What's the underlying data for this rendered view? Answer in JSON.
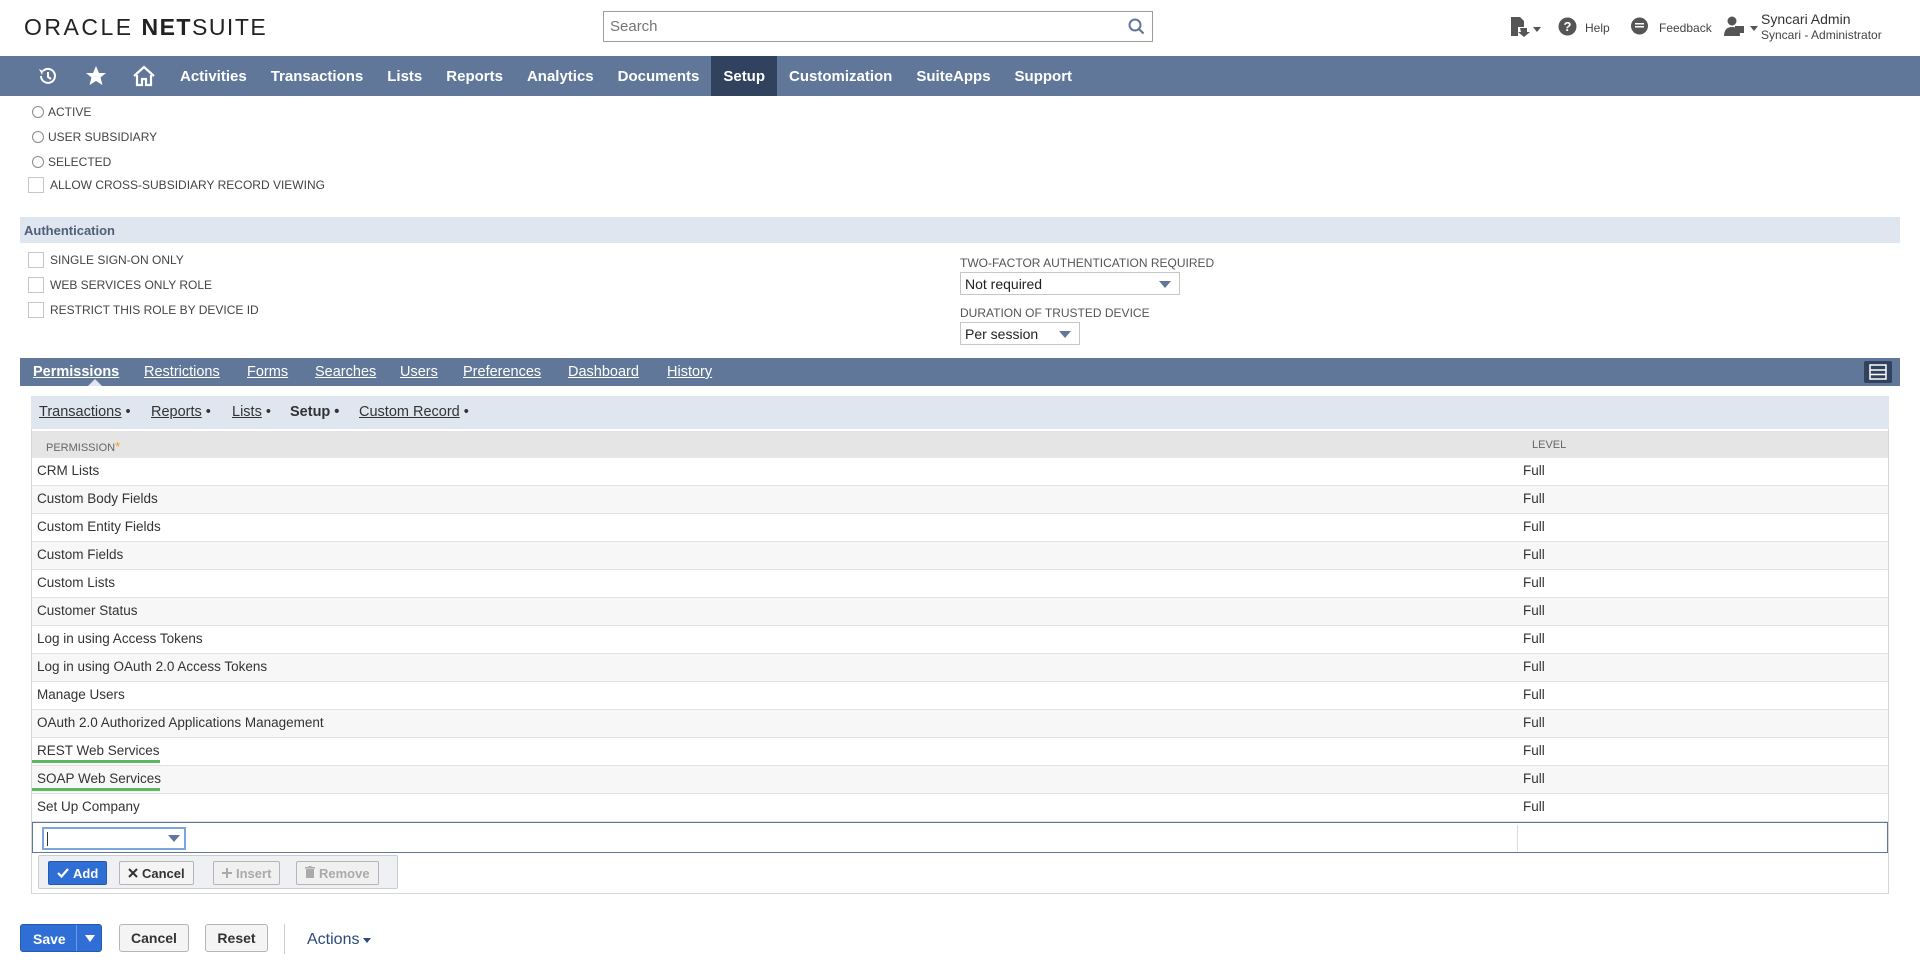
{
  "header": {
    "logo_oracle": "ORACLE",
    "logo_net": "NET",
    "logo_suite": "SUITE",
    "search_placeholder": "Search",
    "help_label": "Help",
    "feedback_label": "Feedback",
    "user_name": "Syncari Admin",
    "user_role": "Syncari - Administrator"
  },
  "nav": {
    "items": [
      "Activities",
      "Transactions",
      "Lists",
      "Reports",
      "Analytics",
      "Documents",
      "Setup",
      "Customization",
      "SuiteApps",
      "Support"
    ],
    "active": "Setup"
  },
  "subsidiary_options": {
    "radio_active": "ACTIVE",
    "radio_user_subsidiary": "USER SUBSIDIARY",
    "radio_selected": "SELECTED",
    "cross_subsidiary": "ALLOW CROSS-SUBSIDIARY RECORD VIEWING"
  },
  "authentication": {
    "title": "Authentication",
    "sso_only": "SINGLE SIGN-ON ONLY",
    "web_services_only": "WEB SERVICES ONLY ROLE",
    "restrict_device": "RESTRICT THIS ROLE BY DEVICE ID",
    "two_factor_label": "TWO-FACTOR AUTHENTICATION REQUIRED",
    "two_factor_value": "Not required",
    "duration_label": "DURATION OF TRUSTED DEVICE",
    "duration_value": "Per session"
  },
  "tabs": {
    "items": [
      "Permissions",
      "Restrictions",
      "Forms",
      "Searches",
      "Users",
      "Preferences",
      "Dashboard",
      "History"
    ],
    "active": "Permissions"
  },
  "subtabs": {
    "items": [
      "Transactions",
      "Reports",
      "Lists",
      "Setup",
      "Custom Record"
    ],
    "active": "Setup"
  },
  "table": {
    "col_permission": "PERMISSION",
    "col_required": "*",
    "col_level": "LEVEL",
    "rows": [
      {
        "permission": "CRM Lists",
        "level": "Full"
      },
      {
        "permission": "Custom Body Fields",
        "level": "Full"
      },
      {
        "permission": "Custom Entity Fields",
        "level": "Full"
      },
      {
        "permission": "Custom Fields",
        "level": "Full"
      },
      {
        "permission": "Custom Lists",
        "level": "Full"
      },
      {
        "permission": "Customer Status",
        "level": "Full"
      },
      {
        "permission": "Log in using Access Tokens",
        "level": "Full"
      },
      {
        "permission": "Log in using OAuth 2.0 Access Tokens",
        "level": "Full"
      },
      {
        "permission": "Manage Users",
        "level": "Full"
      },
      {
        "permission": "OAuth 2.0 Authorized Applications Management",
        "level": "Full"
      },
      {
        "permission": "REST Web Services",
        "level": "Full"
      },
      {
        "permission": "SOAP Web Services",
        "level": "Full"
      },
      {
        "permission": "Set Up Company",
        "level": "Full"
      }
    ]
  },
  "machine_buttons": {
    "add": "Add",
    "cancel": "Cancel",
    "insert": "Insert",
    "remove": "Remove"
  },
  "footer": {
    "save": "Save",
    "cancel": "Cancel",
    "reset": "Reset",
    "actions": "Actions"
  },
  "colors": {
    "nav_bg": "#607799",
    "nav_active": "#30425e",
    "primary_button": "#2f6fd5",
    "highlight_underline": "#5cb85c"
  }
}
